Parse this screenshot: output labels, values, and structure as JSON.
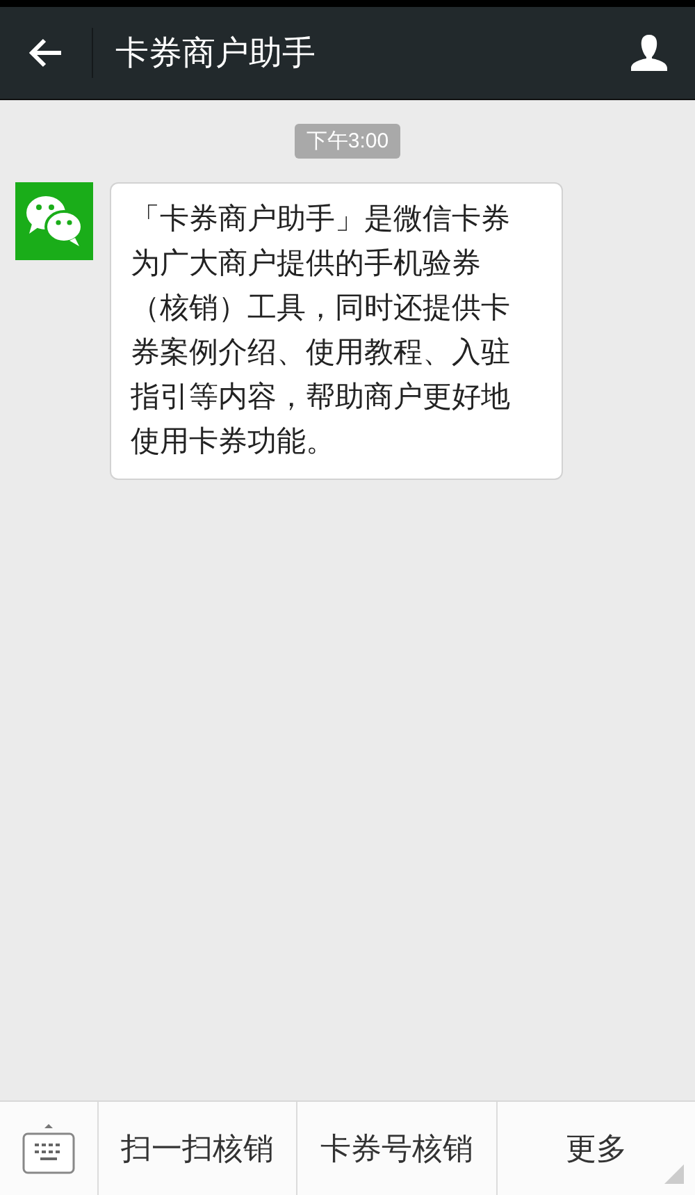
{
  "header": {
    "title": "卡券商户助手"
  },
  "messages": [
    {
      "kind": "time",
      "text": "下午3:00"
    },
    {
      "kind": "incoming",
      "text": "「卡券商户助手」是微信卡券为广大商户提供的手机验券（核销）工具，同时还提供卡券案例介绍、使用教程、入驻指引等内容，帮助商户更好地使用卡券功能。"
    }
  ],
  "menu": [
    {
      "label": "扫一扫核销",
      "kind": "action"
    },
    {
      "label": "卡券号核销",
      "kind": "action"
    },
    {
      "label": "更多",
      "kind": "submenu"
    }
  ]
}
